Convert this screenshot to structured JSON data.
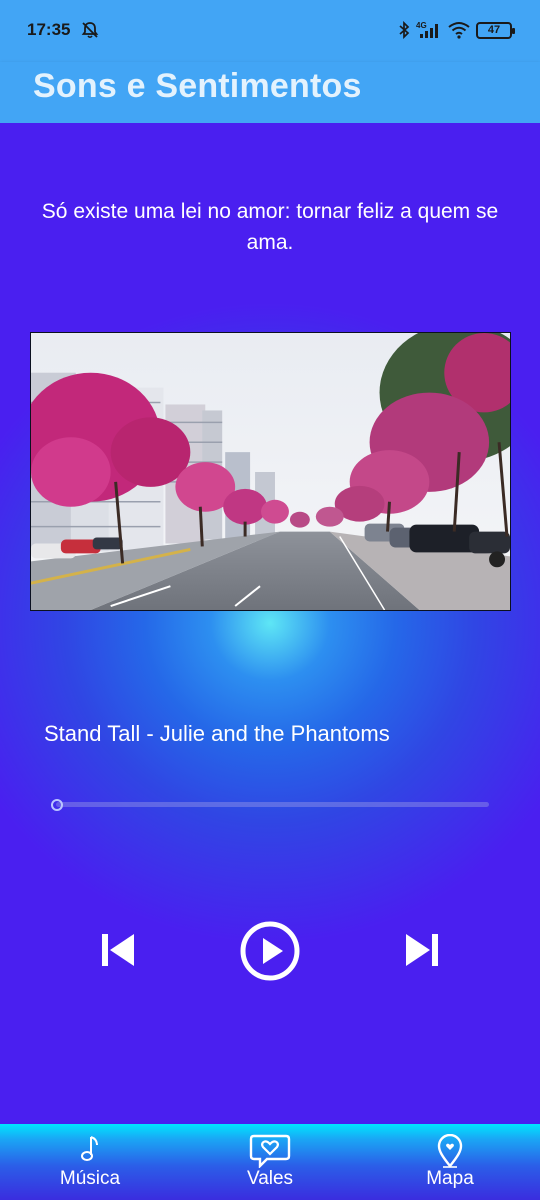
{
  "status_bar": {
    "time": "17:35",
    "network": "4G",
    "battery": "47",
    "icons": [
      "mute-icon",
      "bluetooth-icon",
      "signal-icon",
      "wifi-icon",
      "battery-icon"
    ]
  },
  "app_bar": {
    "title": "Sons e Sentimentos"
  },
  "main": {
    "quote": "Só existe uma lei no amor: tornar feliz a quem se ama.",
    "song_title": "Stand Tall - Julie and the Phantoms",
    "progress": 0,
    "controls": [
      "previous-icon",
      "play-icon",
      "next-icon"
    ]
  },
  "bottom_nav": {
    "items": [
      {
        "label": "Música",
        "icon": "music-note-icon"
      },
      {
        "label": "Vales",
        "icon": "heart-chat-icon"
      },
      {
        "label": "Mapa",
        "icon": "map-pin-icon"
      }
    ]
  },
  "colors": {
    "app_bar": "#42a5f5",
    "title_text": "#e3f2fd",
    "background": "#4a1ff0",
    "glow": "#5ee6f5"
  }
}
